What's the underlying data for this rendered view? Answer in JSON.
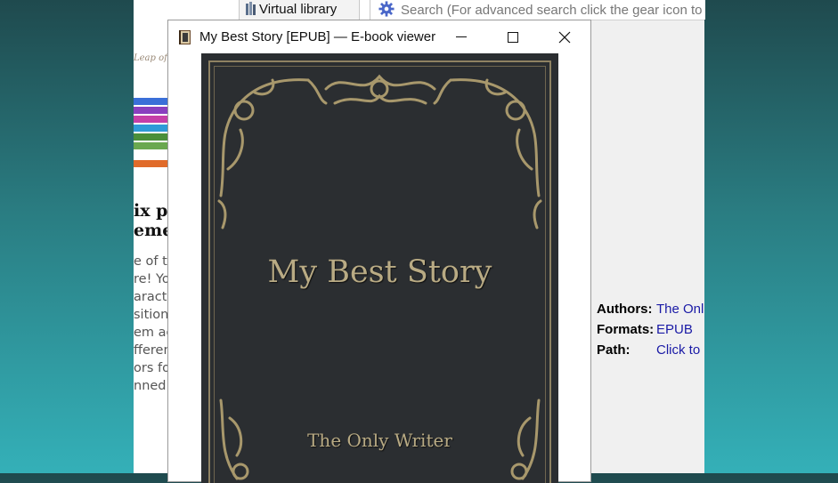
{
  "background_article": {
    "logo_fragment": "Leap of F",
    "headline_lines": [
      "ix po",
      "eme"
    ],
    "paragraph_lines": [
      "e of t",
      "re! Yo",
      "aract",
      "sition",
      "em ag",
      "fferen",
      "ors fo",
      "nned r"
    ],
    "thumbnail_colors": [
      "#ffffff",
      "#3a6fd8",
      "#8a3fbf",
      "#c63fa8",
      "#2f9ad8",
      "#4a8f3a",
      "#6aa84f",
      "#ffffff",
      "#e06b2a"
    ]
  },
  "calibre": {
    "virtual_library_label": "Virtual library",
    "search_placeholder": "Search (For advanced search click the gear icon to t",
    "details": {
      "authors_label": "Authors:",
      "authors_value": "The Onl",
      "formats_label": "Formats:",
      "formats_value": "EPUB",
      "path_label": "Path:",
      "path_value": "Click to"
    },
    "link_color": "#1a1aa6"
  },
  "viewer": {
    "window_title": "My Best Story [EPUB] — E-book viewer",
    "icons": {
      "app": "ebook-viewer-icon",
      "minimize": "minimize-icon",
      "maximize": "maximize-icon",
      "close": "close-icon"
    },
    "cover": {
      "title": "My Best Story",
      "author": "The Only Writer",
      "background_color": "#2b2e31",
      "text_color": "#b9ab84"
    }
  }
}
